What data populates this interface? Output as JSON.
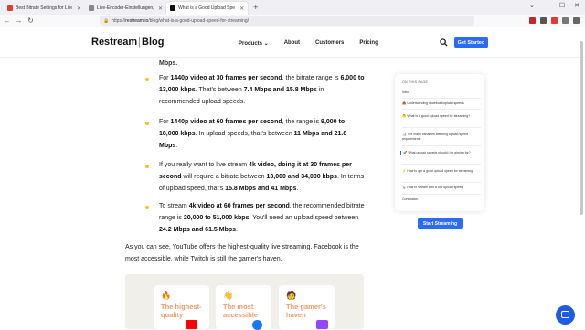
{
  "browser": {
    "tabs": [
      {
        "title": "Best Bitrate Settings for Live St",
        "favicon_color": "#e53935",
        "active": false
      },
      {
        "title": "Live-Encoder-Einstellungen, Bi",
        "favicon_color": "#888888",
        "active": false
      },
      {
        "title": "What is a Good Upload Speed f",
        "favicon_color": "#111111",
        "active": true
      }
    ],
    "new_tab": "+",
    "url_scheme": "https://",
    "url_host": "restream.io",
    "url_path": "/blog/what-is-a-good-upload-speed-for-streaming/"
  },
  "header": {
    "logo_main": "Restream",
    "logo_sep": "|",
    "logo_sub": "Blog",
    "menu": [
      "Products",
      "About",
      "Customers",
      "Pricing"
    ],
    "get_started": "Get Started"
  },
  "article": {
    "cutoff": "Mbps.",
    "bullets": [
      {
        "pre": "For ",
        "b1": "1440p video at 30 frames per second",
        "m1": ", the bitrate range is ",
        "b2": "6,000 to 13,000 kbps",
        "m2": ". That's between ",
        "b3": "7.4 Mbps and 15.8 Mbps",
        "post": " in recommended upload speeds."
      },
      {
        "pre": "For ",
        "b1": "1440p video at 60 frames per second",
        "m1": ", the range is ",
        "b2": "9,000 to 18,000 kbps",
        "m2": ". In upload speeds, that's between ",
        "b3": "11 Mbps and 21.8 Mbps",
        "post": "."
      },
      {
        "pre": "If you really want to live stream ",
        "b1": "4k video, doing it at 30 frames per second",
        "m1": " will require a bitrate between ",
        "b2": "13,000 and 34,000 kbps",
        "m2": ". In terms of upload speed, that's ",
        "b3": "15.8 Mbps and 41 Mbps",
        "post": "."
      },
      {
        "pre": "To stream ",
        "b1": "4k video at 60 frames per second",
        "m1": ", the recommended bitrate range is ",
        "b2": "20,000 to 51,000 kbps",
        "m2": ". You'll need an upload speed between ",
        "b3": "24.2 Mbps and 61.5 Mbps",
        "post": "."
      }
    ],
    "summary": "As you can see, YouTube offers the highest-quality live streaming. Facebook is the most accessible, while Twitch is still the gamer's haven.",
    "cards": [
      {
        "emoji": "🔥",
        "title": "The highest-quality",
        "color": "#f29a6b",
        "brand_color": "#ff0000"
      },
      {
        "emoji": "👋",
        "title": "The most accessible",
        "color": "#f29a6b",
        "brand_color": "#1877f2"
      },
      {
        "emoji": "🧑",
        "title": "The gamer's haven",
        "color": "#f29a6b",
        "brand_color": "#9146ff"
      }
    ]
  },
  "toc": {
    "title": "ON THIS PAGE",
    "items": [
      {
        "text": "Intro",
        "active": false
      },
      {
        "text": "📥 Understanding download/upload speeds",
        "active": false
      },
      {
        "text": "🤔 What is a good upload speed for streaming?",
        "active": false
      },
      {
        "text": "📊 The many variables affecting upload speed requirements",
        "active": false
      },
      {
        "text": "🚀 What upload speeds should I be aiming for?",
        "active": true
      },
      {
        "text": "⚡ How to get a good upload speed for streaming",
        "active": false
      },
      {
        "text": "📡 How to stream with a low upload speed",
        "active": false
      },
      {
        "text": "Conclusion",
        "active": false
      }
    ],
    "button": "Start Streaming"
  },
  "colors": {
    "accent": "#2a6cf3",
    "bullet": "#f5c21b"
  }
}
